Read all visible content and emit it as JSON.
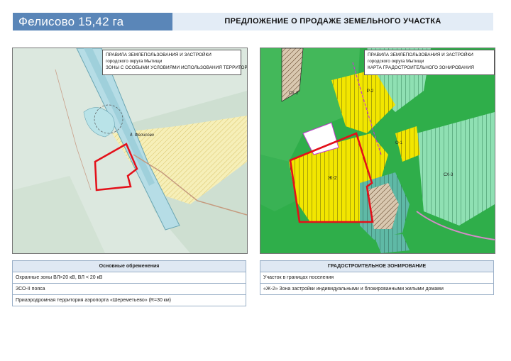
{
  "header": {
    "title": "Фелисово 15,42 га",
    "banner": "ПРЕДЛОЖЕНИЕ О ПРОДАЖЕ ЗЕМЕЛЬНОГО УЧАСТКА"
  },
  "left_map": {
    "legend": [
      "ПРАВИЛА ЗЕМЛЕПОЛЬЗОВАНИЯ И ЗАСТРОЙКИ",
      "городского округа Мытищи",
      "ЗОНЫ С ОСОБЫМИ УСЛОВИЯМИ ИСПОЛЬЗОВАНИЯ ТЕРРИТОРИИ"
    ],
    "place_label": "д. Фелисово"
  },
  "right_map": {
    "legend": [
      "ПРАВИЛА ЗЕМЛЕПОЛЬЗОВАНИЯ И ЗАСТРОЙКИ",
      "городского округа Мытищи",
      "КАРТА ГРАДОСТРОИТЕЛЬНОГО ЗОНИРОВАНИЯ"
    ],
    "zone_labels": [
      "Ж-2",
      "СХ-2",
      "СХ-3",
      "Р-2",
      "О-1"
    ]
  },
  "encumbrances": {
    "heading": "Основные обременения",
    "rows": [
      "Охранные зоны ВЛ>20 кВ, ВЛ < 20 кВ",
      "ЗСО-II пояса",
      "Приаэродромная территория аэропорта «Шереметьево» (R=30 км)"
    ]
  },
  "zoning": {
    "heading": "ГРАДОСТРОИТЕЛЬНОЕ ЗОНИРОВАНИЕ",
    "rows": [
      "Участок в границах поселения",
      "«Ж-2» Зона застройки индивидуальными и блокированными жилыми домами"
    ]
  },
  "colors": {
    "title_bg": "#5a86b8",
    "plot_outline": "#e3101a",
    "zone_residential": "#f2e600",
    "zone_agri": "#4cc784",
    "zone_green": "#2fae4a"
  }
}
